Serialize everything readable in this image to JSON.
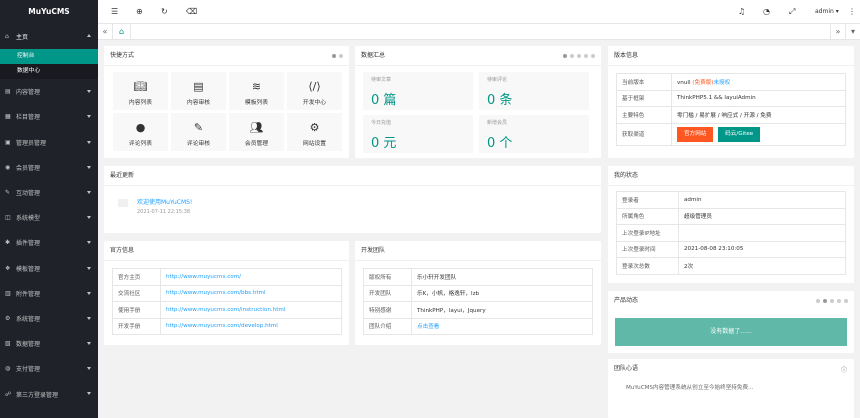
{
  "brand": {
    "name": "MuYuCMS",
    "accent": "#009688"
  },
  "sidebar": {
    "home": {
      "label": "主页",
      "icon": "home-icon"
    },
    "home_sub": [
      {
        "label": "控制台",
        "active": true
      },
      {
        "label": "数据中心",
        "active": false
      }
    ],
    "items": [
      {
        "label": "内容管理",
        "icon": "content-icon"
      },
      {
        "label": "栏目管理",
        "icon": "column-icon"
      },
      {
        "label": "管理员管理",
        "icon": "admin-icon"
      },
      {
        "label": "会员管理",
        "icon": "member-icon"
      },
      {
        "label": "互动管理",
        "icon": "interact-icon"
      },
      {
        "label": "系统模型",
        "icon": "model-icon"
      },
      {
        "label": "插件管理",
        "icon": "plugin-icon"
      },
      {
        "label": "模板管理",
        "icon": "template-icon"
      },
      {
        "label": "附件管理",
        "icon": "attachment-icon"
      },
      {
        "label": "系统管理",
        "icon": "system-icon"
      },
      {
        "label": "数据管理",
        "icon": "data-icon"
      },
      {
        "label": "支付管理",
        "icon": "pay-icon"
      },
      {
        "label": "第三方登录管理",
        "icon": "oauth-icon"
      }
    ]
  },
  "header": {
    "user": "admin"
  },
  "shortcuts": {
    "title": "快捷方式",
    "items": [
      {
        "label": "内容列表",
        "icon": "book-icon"
      },
      {
        "label": "内容审核",
        "icon": "doc-icon"
      },
      {
        "label": "模板列表",
        "icon": "layers-icon"
      },
      {
        "label": "开发中心",
        "icon": "code-icon"
      },
      {
        "label": "评论列表",
        "icon": "comment-icon"
      },
      {
        "label": "评论审核",
        "icon": "edit-icon"
      },
      {
        "label": "会员管理",
        "icon": "users-icon"
      },
      {
        "label": "网站设置",
        "icon": "settings-icon"
      }
    ]
  },
  "stats": {
    "title": "数据汇总",
    "items": [
      {
        "label": "待审文章",
        "value": "0 篇"
      },
      {
        "label": "待审评论",
        "value": "0 条"
      },
      {
        "label": "今日充值",
        "value": "0 元"
      },
      {
        "label": "新增会员",
        "value": "0 个"
      }
    ]
  },
  "version": {
    "title": "版本信息",
    "rows": [
      {
        "k": "当前版本",
        "v1": "vnull",
        "v2": "(免费版)",
        "v3": "未授权"
      },
      {
        "k": "基于框架",
        "v": "ThinkPHP5.1 && layuiAdmin"
      },
      {
        "k": "主要特色",
        "v": "零门槛 / 易扩展 / 响应式 / 开源 / 免费"
      },
      {
        "k": "获取渠道"
      }
    ],
    "btn_official": "官方网站",
    "btn_gitee": "码云/Gitee",
    "btn_official_color": "#ff5722",
    "btn_gitee_color": "#009688"
  },
  "recent": {
    "title": "最近更新",
    "news_title": "欢迎使用MuYuCMS!",
    "news_time": "2021-07-11 22:15:38"
  },
  "official": {
    "title": "官方信息",
    "rows": [
      {
        "k": "官方主页",
        "v": "http://www.muyucms.com/"
      },
      {
        "k": "交流社区",
        "v": "http://www.muyucms.com/bbs.html"
      },
      {
        "k": "使用手册",
        "v": "http://www.muyucms.com/instruction.html"
      },
      {
        "k": "开发手册",
        "v": "http://www.muyucms.com/develop.html"
      }
    ]
  },
  "team": {
    "title": "开发团队",
    "rows": [
      {
        "k": "版权所有",
        "v": "乐小轩开发团队"
      },
      {
        "k": "开发团队",
        "v": "乐K，小帆，格逸轩，lzb"
      },
      {
        "k": "特别感谢",
        "v": "ThinkPHP，layui，Jquery"
      },
      {
        "k": "团队介绍",
        "v": "点击查看"
      }
    ]
  },
  "status": {
    "title": "我的状态",
    "rows": [
      {
        "k": "登录者",
        "v": "admin"
      },
      {
        "k": "所属角色",
        "v": "超级管理员"
      },
      {
        "k": "上次登录IP地址",
        "v": ""
      },
      {
        "k": "上次登录时间",
        "v": "2021-08-08 23:10:05"
      },
      {
        "k": "登录次总数",
        "v": "2次"
      }
    ]
  },
  "product": {
    "title": "产品动态",
    "empty": "没有数据了......"
  },
  "heart": {
    "title": "团队心语",
    "text": "MuYuCMS内容管理系统从创立至今始终坚持免费..."
  }
}
